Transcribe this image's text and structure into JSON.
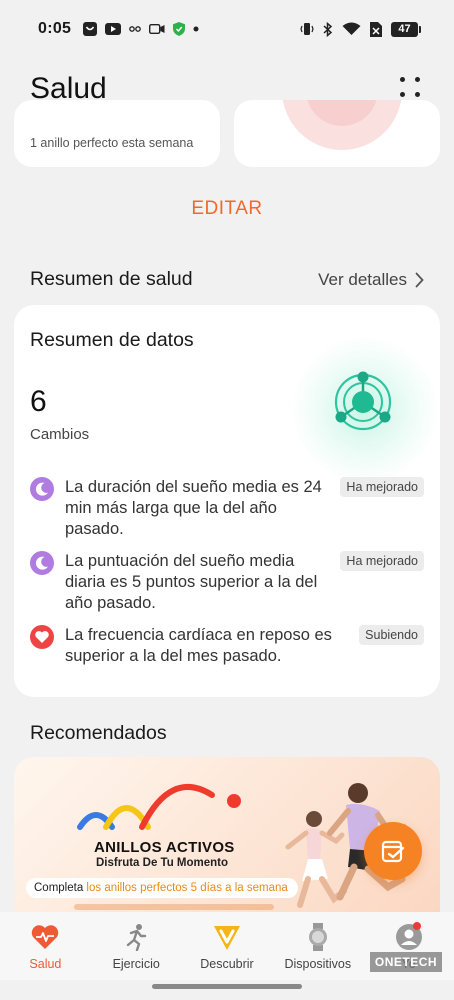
{
  "status_bar": {
    "time": "0:05",
    "battery_level": "47"
  },
  "header": {
    "title": "Salud"
  },
  "top_cards": {
    "left_text": "1 anillo perfecto esta semana"
  },
  "edit_label": "EDITAR",
  "health_summary": {
    "title": "Resumen de salud",
    "details_label": "Ver detalles"
  },
  "data_summary": {
    "title": "Resumen de datos",
    "changes_count": "6",
    "changes_label": "Cambios",
    "rows": [
      {
        "icon": "moon-icon",
        "text": "La duración del sueño media es 24 min más larga que la del año pasado.",
        "badge": "Ha mejorado"
      },
      {
        "icon": "moon-icon",
        "text": "La puntuación del sueño media diaria es 5 puntos superior a la del año pasado.",
        "badge": "Ha mejorado"
      },
      {
        "icon": "heart-icon",
        "text": "La frecuencia cardíaca en reposo es superior a la del mes pasado.",
        "badge": "Subiendo"
      }
    ]
  },
  "recommended": {
    "title": "Recomendados",
    "banner_title": "ANILLOS ACTIVOS",
    "banner_subtitle": "Disfruta De Tu Momento",
    "pill_prefix": "Completa ",
    "pill_highlight": "los anillos perfectos 5 días a la semana"
  },
  "bottom_nav": {
    "items": [
      {
        "label": "Salud",
        "icon": "heart-pulse-icon",
        "active": true
      },
      {
        "label": "Ejercicio",
        "icon": "runner-icon",
        "active": false
      },
      {
        "label": "Descubrir",
        "icon": "vip-badge-icon",
        "active": false
      },
      {
        "label": "Dispositivos",
        "icon": "watch-icon",
        "active": false
      },
      {
        "label": "Yo",
        "icon": "avatar-icon",
        "active": false
      }
    ]
  },
  "watermark": "ONETECH",
  "colors": {
    "accent": "#f0692c",
    "background": "#f1f1f1",
    "card": "#ffffff",
    "teal": "#2ec4a0",
    "moon_purple": "#b07ce0",
    "heart_red": "#ef4444"
  }
}
